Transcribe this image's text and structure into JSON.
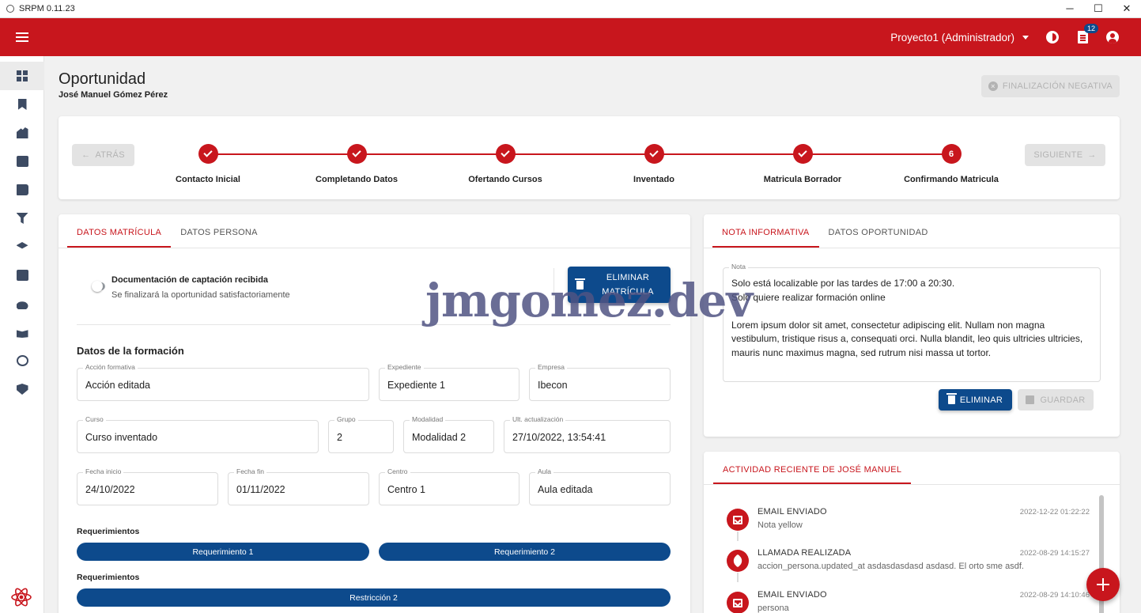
{
  "window": {
    "title": "SRPM 0.11.23",
    "minimize": "─",
    "maximize": "☐",
    "close": "✕"
  },
  "appbar": {
    "project": "Proyecto1 (Administrador)",
    "notifications_count": "12"
  },
  "page": {
    "title": "Oportunidad",
    "subtitle": "José Manuel Gómez Pérez",
    "negative_button": "FINALIZACIÓN NEGATIVA"
  },
  "stepper": {
    "back_label": "ATRÁS",
    "next_label": "SIGUIENTE",
    "steps": [
      {
        "label": "Contacto Inicial",
        "done": true
      },
      {
        "label": "Completando Datos",
        "done": true
      },
      {
        "label": "Ofertando Cursos",
        "done": true
      },
      {
        "label": "Inventado",
        "done": true
      },
      {
        "label": "Matricula Borrador",
        "done": true
      },
      {
        "label": "Confirmando Matricula",
        "number": "6",
        "done": false
      }
    ]
  },
  "left_tabs": [
    "DATOS MATRÍCULA",
    "DATOS PERSONA"
  ],
  "documentation": {
    "title": "Documentación de captación recibida",
    "subtitle": "Se finalizará la oportunidad satisfactoriamente",
    "delete_button": "ELIMINAR MATRÍCULA"
  },
  "formacion": {
    "title": "Datos de la formación",
    "fields": {
      "accion": {
        "label": "Acción formativa",
        "value": "Acción editada"
      },
      "expediente": {
        "label": "Expediente",
        "value": "Expediente 1"
      },
      "empresa": {
        "label": "Empresa",
        "value": "Ibecon"
      },
      "curso": {
        "label": "Curso",
        "value": "Curso inventado"
      },
      "grupo": {
        "label": "Grupo",
        "value": "2"
      },
      "modalidad": {
        "label": "Modalidad",
        "value": "Modalidad 2"
      },
      "actualizacion": {
        "label": "Ult. actualización",
        "value": "27/10/2022, 13:54:41"
      },
      "fecha_inicio": {
        "label": "Fecha inicio",
        "value": "24/10/2022"
      },
      "fecha_fin": {
        "label": "Fecha fin",
        "value": "01/11/2022"
      },
      "centro": {
        "label": "Centro",
        "value": "Centro 1"
      },
      "aula": {
        "label": "Aula",
        "value": "Aula editada"
      }
    },
    "requerimientos_label": "Requerimientos",
    "requerimientos": [
      "Requerimiento 1",
      "Requerimiento 2"
    ],
    "restricciones_label": "Requerimientos",
    "restricciones": [
      "Restricción 2"
    ]
  },
  "note_tabs": [
    "NOTA INFORMATIVA",
    "DATOS OPORTUNIDAD"
  ],
  "note": {
    "label": "Nota",
    "text": "Solo está localizable por las tardes de 17:00 a 20:30.\nSolo quiere realizar formación online\n\nLorem ipsum dolor sit amet, consectetur adipiscing elit. Nullam non magna vestibulum, tristique risus a, consequati orci. Nulla blandit, leo quis ultricies ultricies, mauris nunc maximus magna, sed rutrum nisi massa ut tortor.",
    "delete_button": "ELIMINAR",
    "save_button": "GUARDAR"
  },
  "activity": {
    "tab": "ACTIVIDAD RECIENTE DE JOSÉ MANUEL",
    "items": [
      {
        "icon": "email-icon",
        "title": "EMAIL ENVIADO",
        "desc": "Nota yellow",
        "date": "2022-12-22 01:22:22"
      },
      {
        "icon": "phone-icon",
        "title": "LLAMADA REALIZADA",
        "desc": "accion_persona.updated_at asdasdasdasd asdasd. El orto sme asdf.",
        "date": "2022-08-29 14:15:27"
      },
      {
        "icon": "email-icon",
        "title": "EMAIL ENVIADO",
        "desc": "persona",
        "date": "2022-08-29 14:10:46"
      }
    ]
  },
  "watermark": "jmgomez.dev",
  "colors": {
    "primary_red": "#c8161d",
    "primary_blue": "#0d4a8c",
    "sidebar_icon": "#3d4b63"
  }
}
